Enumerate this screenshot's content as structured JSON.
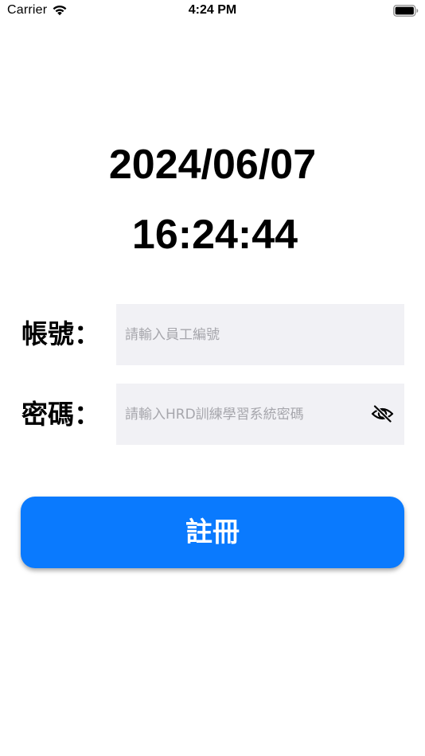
{
  "status_bar": {
    "carrier": "Carrier",
    "time": "4:24 PM",
    "icons": [
      "wifi-icon",
      "battery-icon"
    ]
  },
  "clock_display": {
    "date": "2024/06/07",
    "time": "16:24:44"
  },
  "form": {
    "account_label": "帳號：",
    "account_placeholder": "請輸入員工編號",
    "account_value": "",
    "password_label": "密碼：",
    "password_placeholder": "請輸入HRD訓練學習系統密碼",
    "password_value": "",
    "password_toggle_icon": "eye-slash-icon"
  },
  "actions": {
    "register_label": "註冊"
  },
  "colors": {
    "accent": "#0a7afe",
    "field_background": "#f1f1f5",
    "placeholder": "#a6a6ac"
  }
}
